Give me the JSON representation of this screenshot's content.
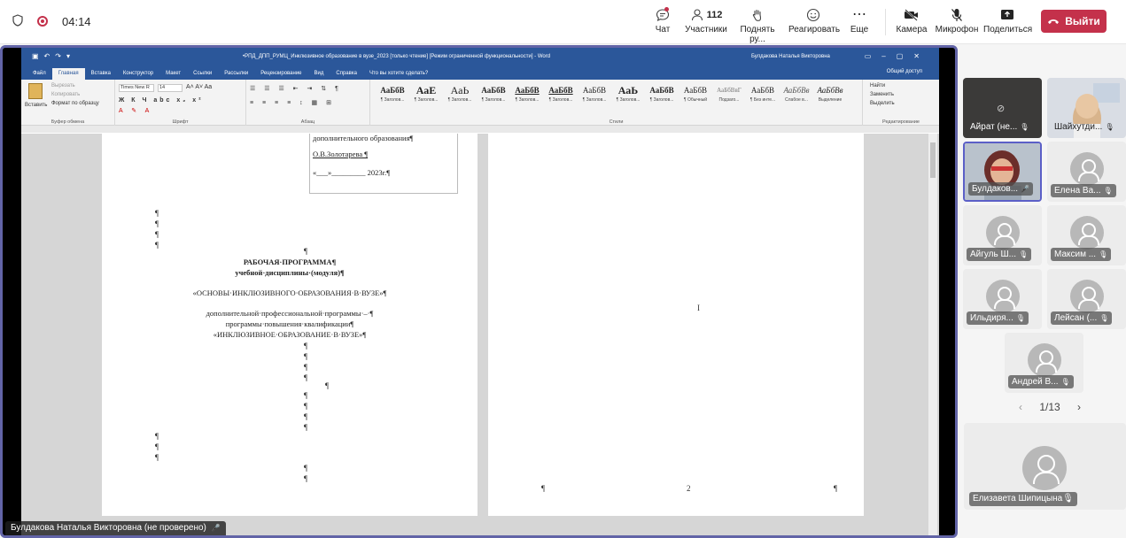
{
  "topbar": {
    "timer": "04:14",
    "chat_label": "Чат",
    "participants_count": "112",
    "participants_label": "Участники",
    "raise_hand_label": "Поднять ру...",
    "react_label": "Реагировать",
    "more_label": "Еще",
    "camera_label": "Камера",
    "mic_label": "Микрофон",
    "share_label": "Поделиться",
    "leave_label": "Выйти"
  },
  "word": {
    "title": "•РПД_ДПП_РУМЦ_Инклюзивное образование в вузе_2023 [только чтение] [Режим ограниченной функциональности] - Word",
    "user": "Булдакова Наталья Викторовна",
    "tabs": [
      "Файл",
      "Главная",
      "Вставка",
      "Конструктор",
      "Макет",
      "Ссылки",
      "Рассылки",
      "Рецензирование",
      "Вид",
      "Справка",
      "Что вы хотите сделать?"
    ],
    "share": "Общий доступ",
    "clipboard": {
      "paste": "Вставить",
      "cut": "Вырезать",
      "copy": "Копировать",
      "format": "Формат по образцу",
      "label": "Буфер обмена"
    },
    "font": {
      "name": "Times New R",
      "size": "14",
      "label": "Шрифт"
    },
    "paragraph_label": "Абзац",
    "styles_label": "Стили",
    "styles": [
      {
        "sample": "АаБбВ",
        "name": "¶ Заголов..."
      },
      {
        "sample": "АаЕ",
        "name": "¶ Заголов..."
      },
      {
        "sample": "АаЬ",
        "name": "¶ Заголов..."
      },
      {
        "sample": "АаБбВ",
        "name": "¶ Заголов..."
      },
      {
        "sample": "АаБбВ",
        "name": "¶ Заголов..."
      },
      {
        "sample": "АаБбВ",
        "name": "¶ Заголов..."
      },
      {
        "sample": "АаБбВ",
        "name": "¶ Заголов..."
      },
      {
        "sample": "АаЬ",
        "name": "¶ Заголов..."
      },
      {
        "sample": "АаБбВ",
        "name": "¶ Заголов..."
      },
      {
        "sample": "АаБбВ",
        "name": "¶ Обычный"
      },
      {
        "sample": "АаБбВвГ",
        "name": "Подзаго..."
      },
      {
        "sample": "АаБбВ",
        "name": "¶ Без инте..."
      },
      {
        "sample": "АаБбВв",
        "name": "Слабое в..."
      },
      {
        "sample": "АаБбВв",
        "name": "Выделение"
      }
    ],
    "editing": {
      "find": "Найти",
      "replace": "Заменить",
      "select": "Выделить",
      "label": "Редактирование"
    },
    "page1": {
      "table_line1": "дополнительного образования¶",
      "table_line2": "О.В.Золотарева ¶",
      "table_line3": "«___»_________ 2023г.¶",
      "title1": "РАБОЧАЯ·ПРОГРАММА¶",
      "title2": "учебной·дисциплины·(модуля)¶",
      "title3": "«ОСНОВЫ·ИНКЛЮЗИВНОГО·ОБРАЗОВАНИЯ·В·ВУЗЕ»¶",
      "title4": "дополнительной·профессиональной·программы·–·¶",
      "title5": "программы·повышения·квалификации¶",
      "title6": "«ИНКЛЮЗИВНОЕ·ОБРАЗОВАНИЕ·В·ВУЗЕ»¶"
    },
    "page2": {
      "page_number": "2"
    }
  },
  "speaker_label": "Булдакова Наталья Викторовна (не проверено)",
  "participants": [
    {
      "name": "Айрат (не..."
    },
    {
      "name": "Шайхутди..."
    },
    {
      "name": "Булдаков..."
    },
    {
      "name": "Елена Ва..."
    },
    {
      "name": "Айгуль Ш..."
    },
    {
      "name": "Максим ..."
    },
    {
      "name": "Ильдиря..."
    },
    {
      "name": "Лейсан (..."
    },
    {
      "name": "Андрей В..."
    }
  ],
  "pager": "1/13",
  "spotlight": {
    "name": "Елизавета Шипицына"
  },
  "colors": {
    "accent": "#6264a7",
    "leave": "#c4314b",
    "word_blue": "#2b579a"
  }
}
